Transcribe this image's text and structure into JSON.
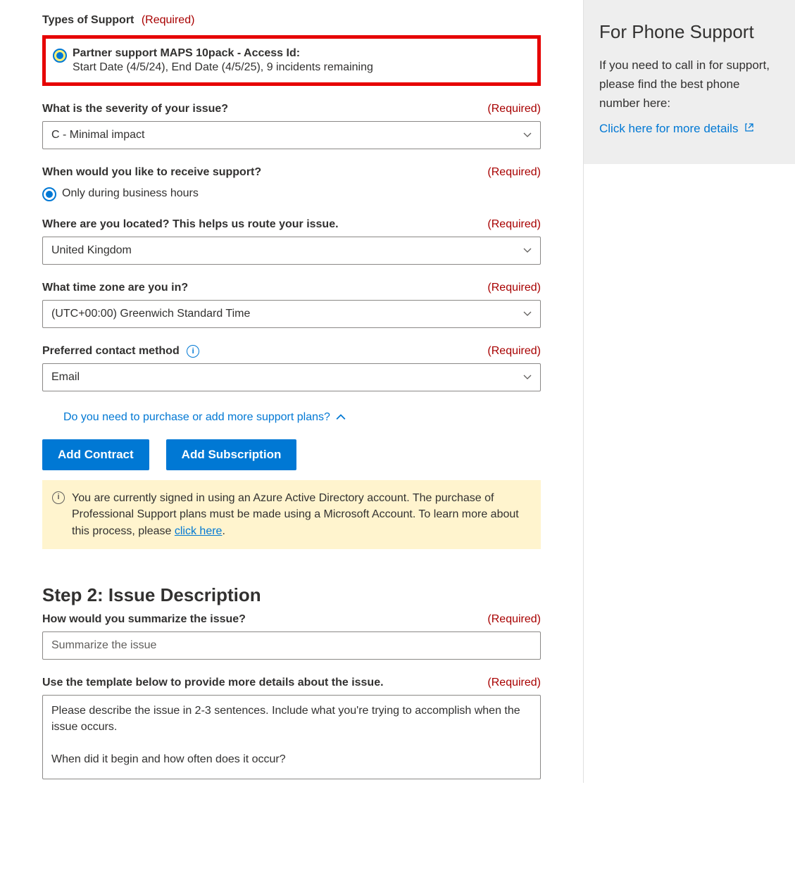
{
  "form": {
    "types_label": "Types of Support",
    "required": "(Required)",
    "radio_option": {
      "title": "Partner support MAPS 10pack - Access Id:",
      "sub": "Start Date (4/5/24), End Date (4/5/25), 9 incidents remaining"
    },
    "severity": {
      "label": "What is the severity of your issue?",
      "value": "C - Minimal impact"
    },
    "when": {
      "label": "When would you like to receive support?",
      "option": "Only during business hours"
    },
    "location": {
      "label": "Where are you located? This helps us route your issue.",
      "value": "United Kingdom"
    },
    "timezone": {
      "label": "What time zone are you in?",
      "value": "(UTC+00:00) Greenwich Standard Time"
    },
    "contact": {
      "label": "Preferred contact method",
      "value": "Email"
    },
    "expand_text": "Do you need to purchase or add more support plans?",
    "add_contract": "Add Contract",
    "add_subscription": "Add Subscription",
    "notice_text": "You are currently signed in using an Azure Active Directory account. The purchase of Professional Support plans must be made using a Microsoft Account. To learn more about this process, please ",
    "notice_link": "click here",
    "notice_period": ".",
    "step2": "Step 2: Issue Description",
    "summary": {
      "label": "How would you summarize the issue?",
      "placeholder": "Summarize the issue"
    },
    "details": {
      "label": "Use the template below to provide more details about the issue.",
      "value": "Please describe the issue in 2-3 sentences. Include what you're trying to accomplish when the issue occurs.\n\nWhen did it begin and how often does it occur?"
    }
  },
  "sidebar": {
    "title": "For Phone Support",
    "body": "If you need to call in for support, please find the best phone number here:",
    "link": "Click here for more details"
  }
}
